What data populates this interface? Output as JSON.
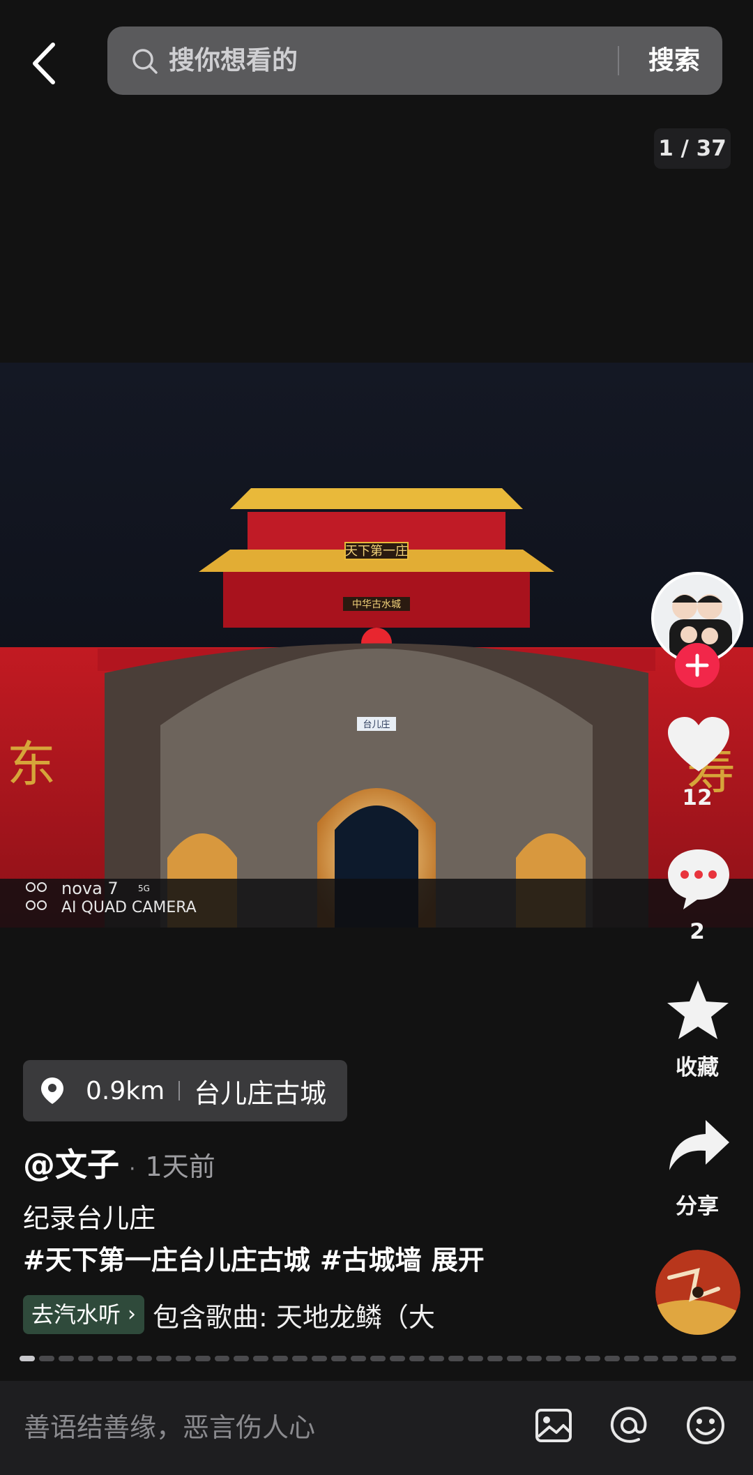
{
  "search": {
    "placeholder": "搜你想看的",
    "button": "搜索"
  },
  "gallery": {
    "counter": "1 / 37"
  },
  "photo": {
    "watermark_line1": "nova 7",
    "watermark_badge": "5G",
    "watermark_line2": "AI QUAD CAMERA",
    "plaque_top": "天下第一庄",
    "plaque_mid": "中华古水城",
    "plaque_gate": "台儿庄",
    "wall_left": "东",
    "wall_right": "寿"
  },
  "actions": {
    "likes": "12",
    "comments": "2",
    "favorite_label": "收藏",
    "share_label": "分享"
  },
  "post": {
    "distance": "0.9km",
    "location": "台儿庄古城",
    "author": "@文子",
    "time": "1天前",
    "description": "纪录台儿庄",
    "tags": [
      "#天下第一庄台儿庄古城",
      "#古城墙"
    ],
    "expand": "展开",
    "soda_button": "去汽水听",
    "song": "包含歌曲: 天地龙鳞（大"
  },
  "comment_bar": {
    "placeholder": "善语结善缘，恶言伤人心"
  },
  "colors": {
    "accent_red": "#f2274a",
    "background": "#121212"
  },
  "icons": [
    "back-icon",
    "search-icon",
    "heart-icon",
    "comment-icon",
    "star-icon",
    "share-icon",
    "location-pin-icon",
    "image-icon",
    "at-icon",
    "emoji-icon"
  ]
}
